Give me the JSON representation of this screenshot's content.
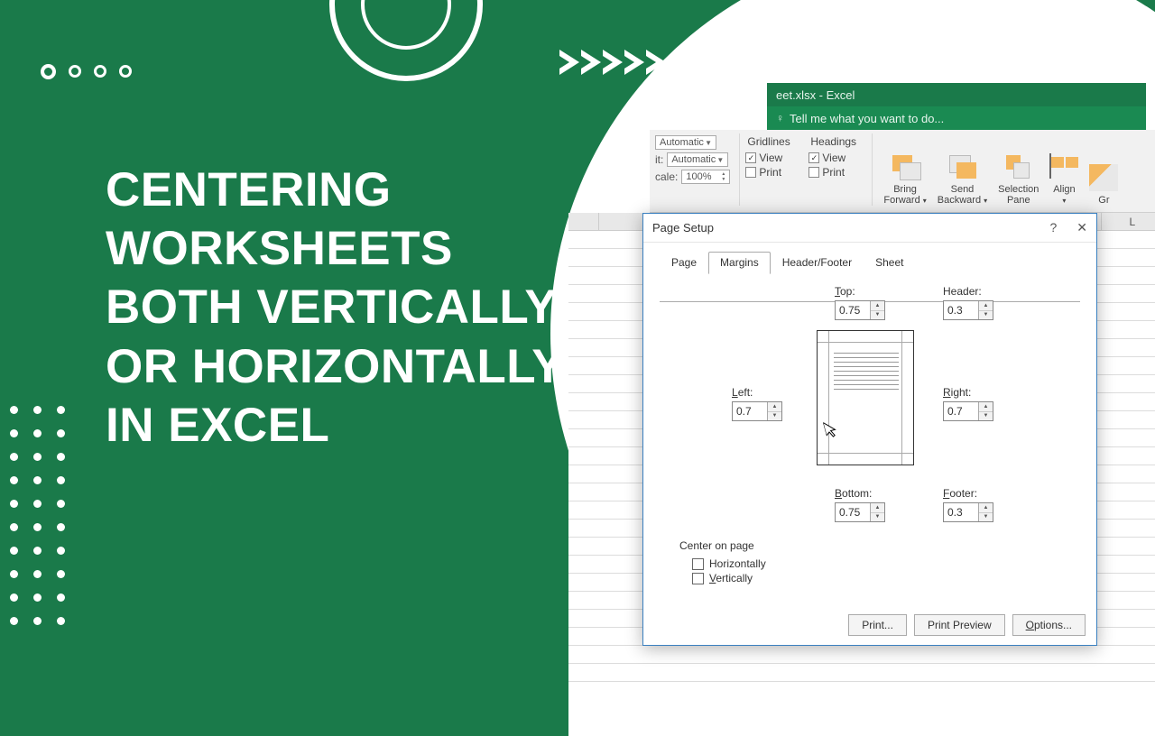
{
  "hero": {
    "title": "CENTERING WORKSHEETS BOTH VERTICALLY OR HORIZONTALLY IN EXCEL"
  },
  "titlebar": {
    "filename": "eet.xlsx - Excel",
    "tellme": "Tell me what you want to do..."
  },
  "ribbon": {
    "scale": {
      "width_label": "Automatic",
      "height_prefix": "it:",
      "height_value": "Automatic",
      "scale_prefix": "cale:",
      "scale_value": "100%"
    },
    "sheetopts": {
      "gridlines": "Gridlines",
      "headings": "Headings",
      "view": "View",
      "print": "Print",
      "gridlines_view": true,
      "gridlines_print": false,
      "headings_view": true,
      "headings_print": false
    },
    "arrange": {
      "bring": "Bring\nForward",
      "send": "Send\nBackward",
      "selpane": "Selection\nPane",
      "align": "Align",
      "gr": "Gr"
    }
  },
  "cols": [
    "",
    "",
    "",
    "",
    "",
    "",
    "",
    "",
    "L"
  ],
  "dialog": {
    "title": "Page Setup",
    "tabs": {
      "page": "Page",
      "margins": "Margins",
      "headerfooter": "Header/Footer",
      "sheet": "Sheet"
    },
    "margins": {
      "top_label": "Top:",
      "top_u": "T",
      "top_rest": "op:",
      "top_val": "0.75",
      "header_label": "Header:",
      "header_u": "",
      "header_rest": "Header:",
      "header_val": "0.3",
      "left_u": "L",
      "left_rest": "eft:",
      "left_val": "0.7",
      "right_u": "R",
      "right_rest": "ight:",
      "right_val": "0.7",
      "bottom_u": "B",
      "bottom_rest": "ottom:",
      "bottom_val": "0.75",
      "footer_u": "F",
      "footer_rest": "ooter:",
      "footer_val": "0.3"
    },
    "center": {
      "heading": "Center on page",
      "horiz_u": "",
      "horiz": "Horizontally",
      "vert_u": "V",
      "vert_rest": "ertically",
      "horiz_checked": false,
      "vert_checked": false
    },
    "buttons": {
      "print": "Print...",
      "preview": "Print Preview",
      "options_u": "O",
      "options_rest": "ptions..."
    }
  }
}
